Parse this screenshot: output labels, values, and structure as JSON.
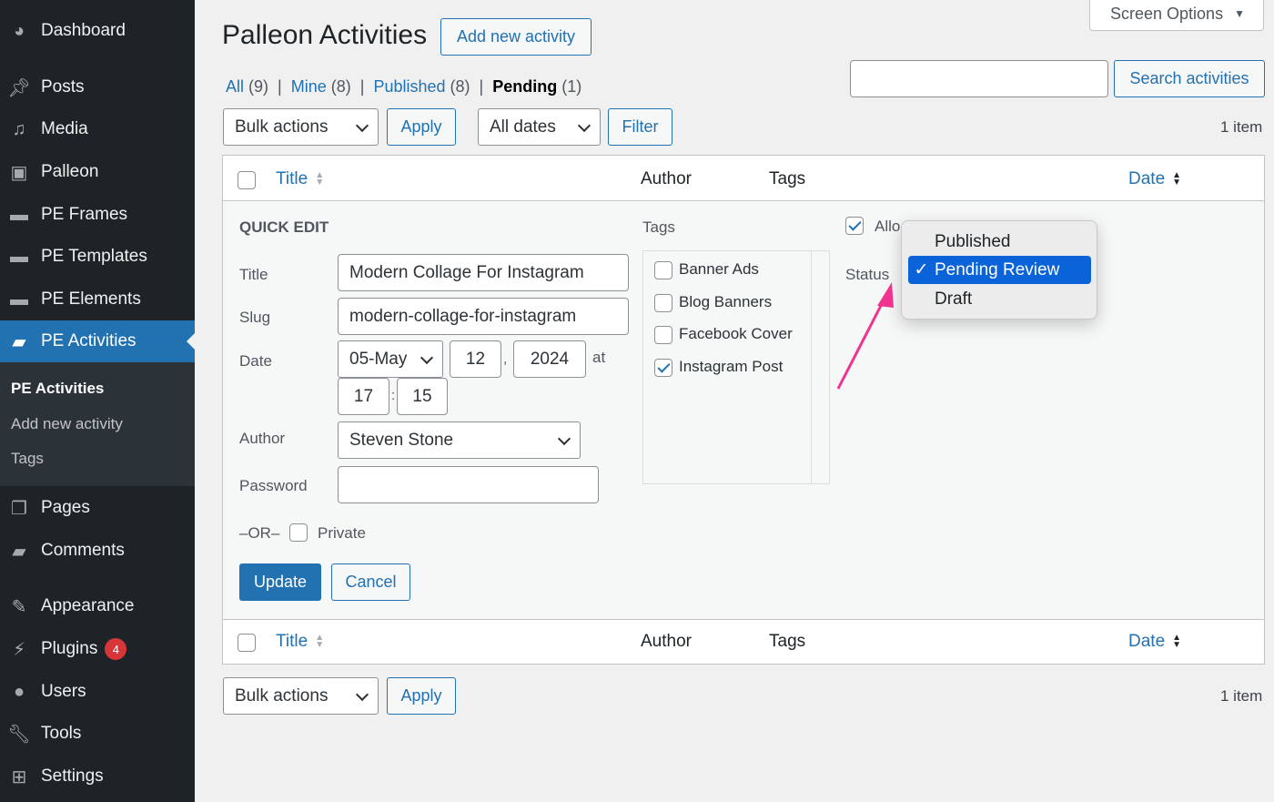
{
  "sidebar": {
    "items": [
      {
        "label": "Dashboard",
        "icon": "dashboard-icon"
      },
      {
        "label": "Posts",
        "icon": "pin-icon"
      },
      {
        "label": "Media",
        "icon": "media-icon"
      },
      {
        "label": "Palleon",
        "icon": "image-icon"
      },
      {
        "label": "PE Frames",
        "icon": "folder-icon"
      },
      {
        "label": "PE Templates",
        "icon": "folder-icon"
      },
      {
        "label": "PE Elements",
        "icon": "folder-icon"
      },
      {
        "label": "PE Activities",
        "icon": "comment-icon"
      },
      {
        "label": "Pages",
        "icon": "pages-icon"
      },
      {
        "label": "Comments",
        "icon": "comment-icon"
      },
      {
        "label": "Appearance",
        "icon": "brush-icon"
      },
      {
        "label": "Plugins",
        "icon": "plug-icon",
        "badge": "4"
      },
      {
        "label": "Users",
        "icon": "user-icon"
      },
      {
        "label": "Tools",
        "icon": "wrench-icon"
      },
      {
        "label": "Settings",
        "icon": "settings-icon"
      }
    ],
    "submenu": [
      "PE Activities",
      "Add new activity",
      "Tags"
    ]
  },
  "header": {
    "title": "Palleon Activities",
    "add_new": "Add new activity",
    "screen_options": "Screen Options"
  },
  "filters": {
    "all": "All",
    "all_count": "(9)",
    "mine": "Mine",
    "mine_count": "(8)",
    "published": "Published",
    "published_count": "(8)",
    "pending": "Pending",
    "pending_count": "(1)"
  },
  "search": {
    "value": "",
    "button": "Search activities"
  },
  "toolbar": {
    "bulk": "Bulk actions",
    "apply": "Apply",
    "dates": "All dates",
    "filter": "Filter",
    "count": "1 item"
  },
  "table": {
    "columns": [
      "Title",
      "Author",
      "Tags",
      "Date"
    ]
  },
  "quick_edit": {
    "heading": "QUICK EDIT",
    "title_label": "Title",
    "title_value": "Modern Collage For Instagram",
    "slug_label": "Slug",
    "slug_value": "modern-collage-for-instagram",
    "date_label": "Date",
    "month": "05-May",
    "day": "12",
    "year": "2024",
    "at": "at",
    "hour": "17",
    "minute": "15",
    "colon": ":",
    "comma": ",",
    "author_label": "Author",
    "author_value": "Steven Stone",
    "password_label": "Password",
    "password_value": "",
    "or": "–OR–",
    "private": "Private",
    "tags_label": "Tags",
    "tags": [
      {
        "label": "Banner Ads",
        "checked": false
      },
      {
        "label": "Blog Banners",
        "checked": false
      },
      {
        "label": "Facebook Cover",
        "checked": false
      },
      {
        "label": "Instagram Post",
        "checked": true
      }
    ],
    "allow_label": "Allo",
    "status_label": "Status",
    "status_options": [
      "Published",
      "Pending Review",
      "Draft"
    ],
    "status_selected": "Pending Review",
    "update": "Update",
    "cancel": "Cancel"
  },
  "colors": {
    "accent": "#2271b1",
    "sidebar": "#1d2327",
    "arrow": "#f0338f",
    "dropdown_highlight": "#0a63d8"
  }
}
